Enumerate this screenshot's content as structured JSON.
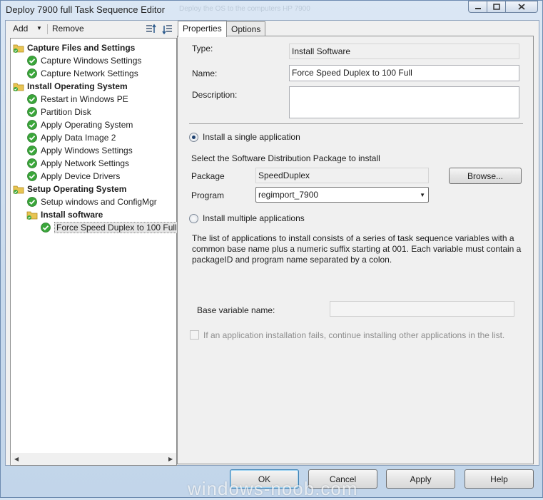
{
  "window": {
    "title": "Deploy 7900 full Task Sequence Editor",
    "ghost_text": "Deploy the OS to the computers HP 7900"
  },
  "toolbar": {
    "add_label": "Add",
    "remove_label": "Remove"
  },
  "tree": {
    "items": [
      {
        "label": "Capture Files and Settings",
        "kind": "group"
      },
      {
        "label": "Capture Windows Settings",
        "kind": "step"
      },
      {
        "label": "Capture Network Settings",
        "kind": "step"
      },
      {
        "label": "Install Operating System",
        "kind": "group"
      },
      {
        "label": "Restart in Windows PE",
        "kind": "step"
      },
      {
        "label": "Partition Disk",
        "kind": "step"
      },
      {
        "label": "Apply Operating System",
        "kind": "step"
      },
      {
        "label": "Apply Data Image 2",
        "kind": "step"
      },
      {
        "label": "Apply Windows Settings",
        "kind": "step"
      },
      {
        "label": "Apply Network Settings",
        "kind": "step"
      },
      {
        "label": "Apply Device Drivers",
        "kind": "step"
      },
      {
        "label": "Setup Operating System",
        "kind": "group"
      },
      {
        "label": "Setup windows and ConfigMgr",
        "kind": "step"
      },
      {
        "label": "Install software",
        "kind": "group"
      },
      {
        "label": "Force Speed Duplex to 100 Full",
        "kind": "step",
        "selected": true
      }
    ]
  },
  "tabs": [
    {
      "label": "Properties",
      "active": true
    },
    {
      "label": "Options",
      "active": false
    }
  ],
  "properties": {
    "type_label": "Type:",
    "type_value": "Install Software",
    "name_label": "Name:",
    "name_value": "Force Speed Duplex to 100 Full",
    "description_label": "Description:",
    "description_value": "",
    "single_app_label": "Install a single application",
    "single_app_selected": true,
    "select_package_text": "Select the Software Distribution Package to install",
    "package_label": "Package",
    "package_value": "SpeedDuplex",
    "browse_label": "Browse...",
    "program_label": "Program",
    "program_value": "regimport_7900",
    "multiple_apps_label": "Install multiple applications",
    "multiple_apps_selected": false,
    "multiple_desc_line1": "The list of applications to install consists of a series of task sequence variables with a",
    "multiple_desc_line2": "common base name plus a numeric suffix starting at 001.  Each variable must contain a",
    "multiple_desc_line3": "packageID and program name separated by a colon.",
    "base_variable_label": "Base variable name:",
    "base_variable_value": "",
    "continue_on_fail_label": "If an application installation fails, continue installing other applications in the list.",
    "continue_on_fail_checked": false
  },
  "dialog_buttons": {
    "ok": "OK",
    "cancel": "Cancel",
    "apply": "Apply",
    "help": "Help"
  },
  "watermark": "windows-noob.com",
  "colors": {
    "frame": "#c7d9ec",
    "check_green": "#3aa63a",
    "folder_yellow": "#e8c452"
  }
}
